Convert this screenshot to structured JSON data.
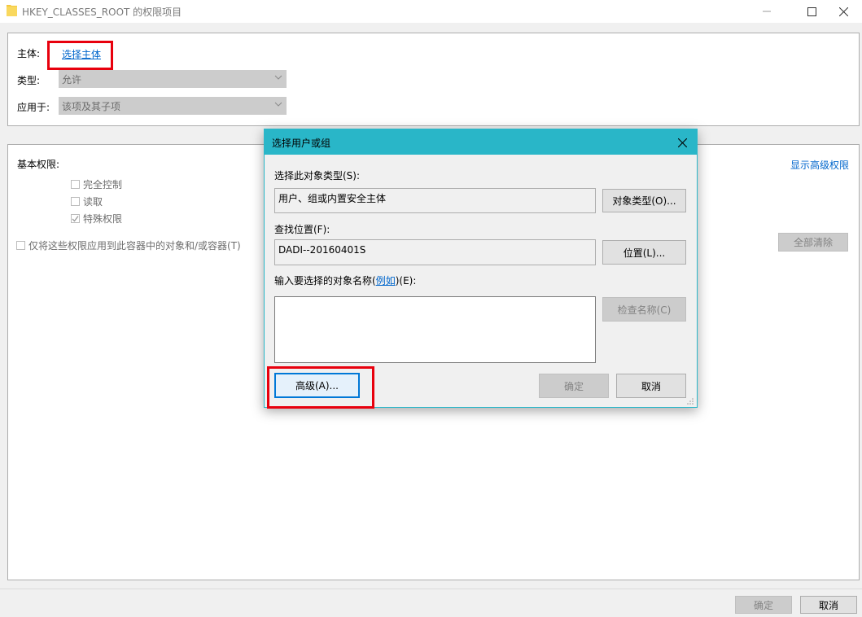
{
  "window": {
    "title": "HKEY_CLASSES_ROOT 的权限项目",
    "minimize_icon": "minimize-icon",
    "maximize_icon": "maximize-icon",
    "close_icon": "close-icon"
  },
  "principal": {
    "label": "主体:",
    "link": "选择主体"
  },
  "type": {
    "label": "类型:",
    "value": "允许"
  },
  "applies_to": {
    "label": "应用于:",
    "value": "该项及其子项"
  },
  "permissions": {
    "heading": "基本权限:",
    "show_advanced": "显示高级权限",
    "items": [
      {
        "label": "完全控制",
        "checked": false
      },
      {
        "label": "读取",
        "checked": false
      },
      {
        "label": "特殊权限",
        "checked": true
      }
    ],
    "apply_only": "仅将这些权限应用到此容器中的对象和/或容器(T)",
    "clear_all": "全部清除"
  },
  "dialog": {
    "title": "选择用户或组",
    "object_type_label": "选择此对象类型(S):",
    "object_type_value": "用户、组或内置安全主体",
    "object_type_button": "对象类型(O)...",
    "location_label": "查找位置(F):",
    "location_value": "DADI--20160401S",
    "location_button": "位置(L)...",
    "name_label_pre": "输入要选择的对象名称(",
    "name_label_link": "例如",
    "name_label_post": ")(E):",
    "check_names_button": "检查名称(C)",
    "advanced_button": "高级(A)...",
    "ok_button": "确定",
    "cancel_button": "取消"
  },
  "footer": {
    "ok": "确定",
    "cancel": "取消"
  },
  "colors": {
    "dialog_title_bar": "#29b6c8",
    "highlight_box": "#e8000d",
    "link": "#0066cc"
  }
}
